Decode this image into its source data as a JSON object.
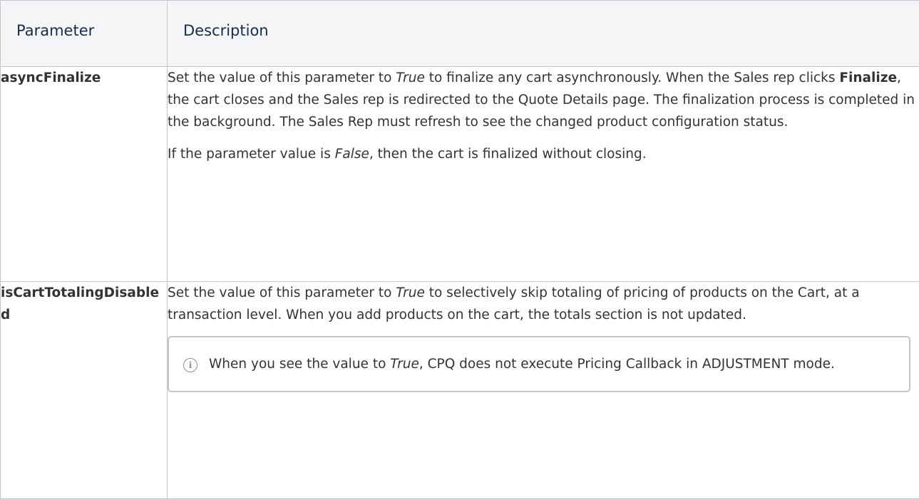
{
  "table": {
    "headers": {
      "parameter": "Parameter",
      "description": "Description"
    },
    "rows": [
      {
        "parameter": "asyncFinalize",
        "para1": {
          "t1": "Set the value of this parameter to ",
          "em1": "True",
          "t2": " to finalize any cart asynchronously. When the Sales rep clicks ",
          "strong1": "Finalize",
          "t3": ", the cart closes and the Sales rep is redirected to the Quote Details page. The finalization process is completed in the background. The Sales Rep must refresh to see the changed product configuration status."
        },
        "para2": {
          "t1": "If the parameter value is ",
          "em1": "False",
          "t2": ", then the cart is finalized without closing."
        }
      },
      {
        "parameter": "isCartTotalingDisabled",
        "para1": {
          "t1": "Set the value of this parameter to ",
          "em1": "True",
          "t2": " to selectively skip totaling of pricing of products on the Cart, at a transaction level.  When you add products on the cart, the totals section is not updated."
        },
        "note": {
          "icon": "info-icon",
          "t1": "When you see the value to ",
          "em1": "True",
          "t2": ", CPQ does not execute Pricing Callback in ADJUSTMENT mode."
        }
      }
    ]
  }
}
